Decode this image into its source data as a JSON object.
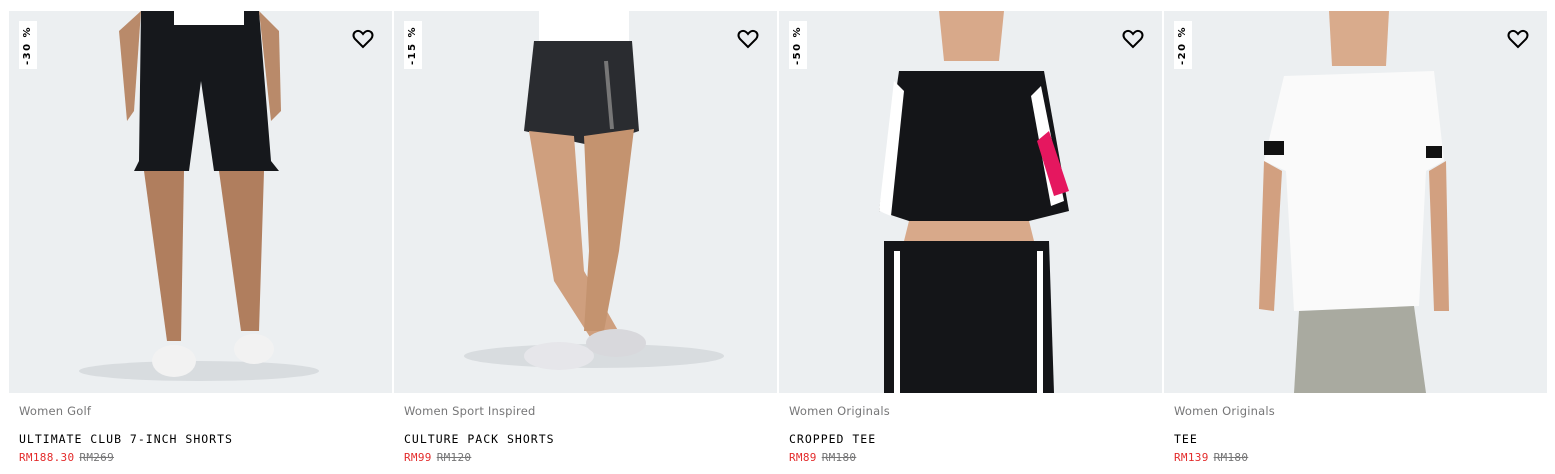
{
  "products": [
    {
      "discount": "-30 %",
      "category": "Women Golf",
      "name": "ULTIMATE CLUB 7-INCH SHORTS",
      "sale_price": "RM188.30",
      "original_price": "RM269",
      "image_icon": "product-photo-black-shorts"
    },
    {
      "discount": "-15 %",
      "category": "Women Sport Inspired",
      "name": "CULTURE PACK SHORTS",
      "sale_price": "RM99",
      "original_price": "RM120",
      "image_icon": "product-photo-black-running-shorts"
    },
    {
      "discount": "-50 %",
      "category": "Women Originals",
      "name": "CROPPED TEE",
      "sale_price": "RM89",
      "original_price": "RM180",
      "image_icon": "product-photo-black-cropped-tee"
    },
    {
      "discount": "-20 %",
      "category": "Women Originals",
      "name": "TEE",
      "sale_price": "RM139",
      "original_price": "RM180",
      "image_icon": "product-photo-white-tee"
    }
  ],
  "colors": {
    "image_bg": "#eceff1",
    "sale_price": "#e32b2b",
    "muted_text": "#767677"
  }
}
